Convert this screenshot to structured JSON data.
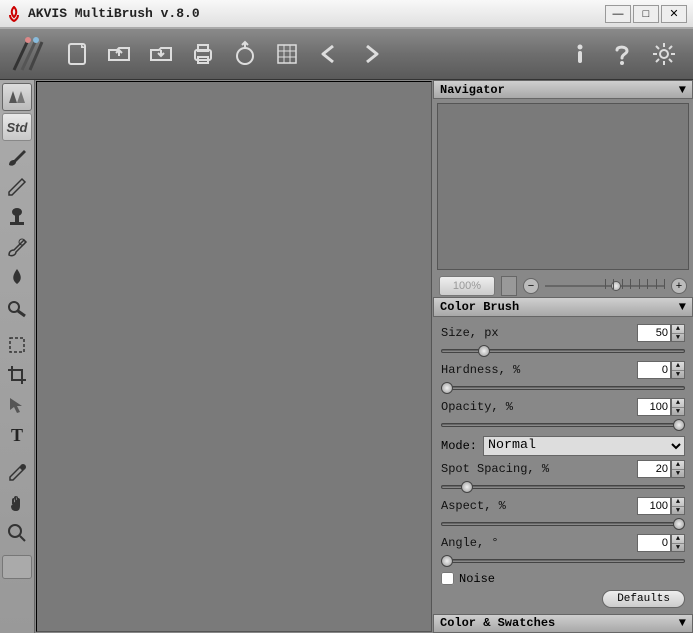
{
  "window": {
    "title": "AKVIS MultiBrush v.8.0"
  },
  "toolbar": {
    "icons": [
      "brushes",
      "new",
      "open",
      "save",
      "print",
      "share",
      "grid",
      "prev",
      "next",
      "info",
      "help",
      "settings"
    ]
  },
  "tools": {
    "std_label": "Std"
  },
  "navigator": {
    "title": "Navigator",
    "zoom": "100%"
  },
  "color_brush": {
    "title": "Color Brush",
    "size_label": "Size, px",
    "size_value": "50",
    "hardness_label": "Hardness, %",
    "hardness_value": "0",
    "opacity_label": "Opacity, %",
    "opacity_value": "100",
    "mode_label": "Mode:",
    "mode_value": "Normal",
    "spot_label": "Spot Spacing, %",
    "spot_value": "20",
    "aspect_label": "Aspect, %",
    "aspect_value": "100",
    "angle_label": "Angle, °",
    "angle_value": "0",
    "noise_label": "Noise",
    "defaults_label": "Defaults"
  },
  "swatches": {
    "title": "Color & Swatches"
  }
}
